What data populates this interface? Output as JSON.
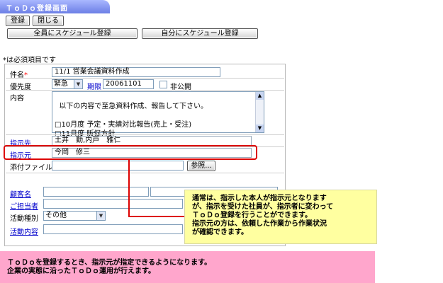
{
  "screen": {
    "title": "ＴｏＤｏ登録画面"
  },
  "toolbar": {
    "register_label": "登録",
    "close_label": "閉じる",
    "schedule_all_label": "全員にスケジュール登録",
    "schedule_self_label": "自分にスケジュール登録"
  },
  "form": {
    "required_note": "*は必須項目です",
    "required_mark": "*",
    "subject": {
      "label": "件名",
      "value": "11/1 営業会議資料作成"
    },
    "priority": {
      "label": "優先度",
      "value": "緊急"
    },
    "deadline": {
      "label": "期限",
      "value": "20061101"
    },
    "private": {
      "label": "非公開",
      "checked": false
    },
    "content": {
      "label": "内容",
      "value": "以下の内容で至急資料作成、報告して下さい。\n\n□10月度 予定・実績対比報告(売上・受注)\n□11月度 販促方針"
    },
    "assignee": {
      "label": "指示先",
      "value": "土井　勤,内戸　雅仁"
    },
    "assigner": {
      "label": "指示元",
      "value": "今岡　修三"
    },
    "attachment": {
      "label": "添付ファイル",
      "browse_label": "参照..."
    },
    "customer": {
      "label": "顧客名"
    },
    "contact": {
      "label": "ご担当者"
    },
    "activity_type": {
      "label": "活動種別",
      "value": "その他"
    },
    "activity_content": {
      "label": "活動内容"
    }
  },
  "callout": {
    "text_lines": [
      "通常は、指示した本人が指示元となります",
      "が、指示を受けた社員が、指示者に変わって",
      "ＴｏＤｏ登録を行うことができます。",
      "指示元の方は、依頼した作業から作業状況",
      "が確認できます。"
    ]
  },
  "note": {
    "line1": "ＴｏＤｏを登録するとき、指示元が指定できるようになります。",
    "line2": "企業の実態に沿ったＴｏＤｏ運用が行えます。"
  },
  "colors": {
    "title_tab": "#7b8ef0",
    "link": "#0000cc",
    "highlight": "#dd0000",
    "callout_bg": "#ffffa0",
    "note_bg": "#ffa6cc"
  }
}
